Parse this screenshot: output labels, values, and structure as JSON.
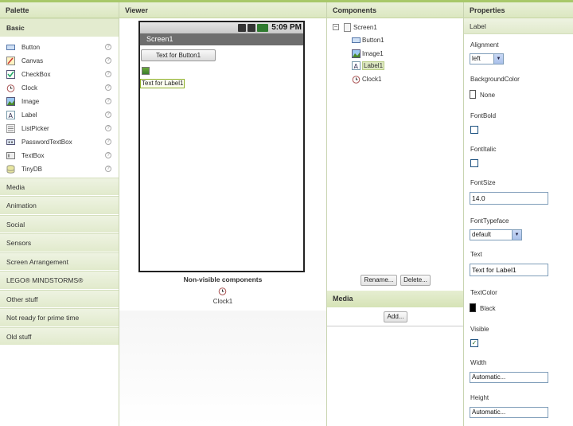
{
  "headers": {
    "palette": "Palette",
    "viewer": "Viewer",
    "components": "Components",
    "properties": "Properties"
  },
  "palette": {
    "basic_label": "Basic",
    "items": [
      {
        "label": "Button",
        "icon": "button-icon"
      },
      {
        "label": "Canvas",
        "icon": "canvas-icon"
      },
      {
        "label": "CheckBox",
        "icon": "checkbox-icon"
      },
      {
        "label": "Clock",
        "icon": "clock-icon"
      },
      {
        "label": "Image",
        "icon": "image-icon"
      },
      {
        "label": "Label",
        "icon": "label-icon"
      },
      {
        "label": "ListPicker",
        "icon": "listpicker-icon"
      },
      {
        "label": "PasswordTextBox",
        "icon": "passwordtextbox-icon"
      },
      {
        "label": "TextBox",
        "icon": "textbox-icon"
      },
      {
        "label": "TinyDB",
        "icon": "tinydb-icon"
      }
    ],
    "help_glyph": "?",
    "sections": [
      "Media",
      "Animation",
      "Social",
      "Sensors",
      "Screen Arrangement",
      "LEGO® MINDSTORMS®",
      "Other stuff",
      "Not ready for prime time",
      "Old stuff"
    ]
  },
  "viewer": {
    "status_time": "5:09 PM",
    "screen_title": "Screen1",
    "button_text": "Text for Button1",
    "label_text": "Text for Label1",
    "nonvisible_title": "Non-visible components",
    "nonvisible_item": "Clock1"
  },
  "components": {
    "tree": [
      {
        "label": "Screen1",
        "icon": "screen-icon"
      },
      {
        "label": "Button1",
        "icon": "button-icon"
      },
      {
        "label": "Image1",
        "icon": "image-icon"
      },
      {
        "label": "Label1",
        "icon": "label-icon",
        "selected": true
      },
      {
        "label": "Clock1",
        "icon": "clock-icon"
      }
    ],
    "toggle_glyph": "−",
    "rename_button": "Rename...",
    "delete_button": "Delete...",
    "media_header": "Media",
    "add_button": "Add..."
  },
  "properties": {
    "component": "Label",
    "alignment_label": "Alignment",
    "alignment_value": "left",
    "bgcolor_label": "BackgroundColor",
    "bgcolor_value": "None",
    "fontbold_label": "FontBold",
    "fontitalic_label": "FontItalic",
    "fontsize_label": "FontSize",
    "fontsize_value": "14.0",
    "fonttypeface_label": "FontTypeface",
    "fonttypeface_value": "default",
    "text_label": "Text",
    "text_value": "Text for Label1",
    "textcolor_label": "TextColor",
    "textcolor_value": "Black",
    "visible_label": "Visible",
    "visible_check": "✓",
    "width_label": "Width",
    "width_value": "Automatic...",
    "height_label": "Height",
    "height_value": "Automatic..."
  },
  "colors": {
    "accent_green": "#a8c86a",
    "header_bg": "#dbe7c0",
    "selected_bg": "#dde8c0"
  }
}
